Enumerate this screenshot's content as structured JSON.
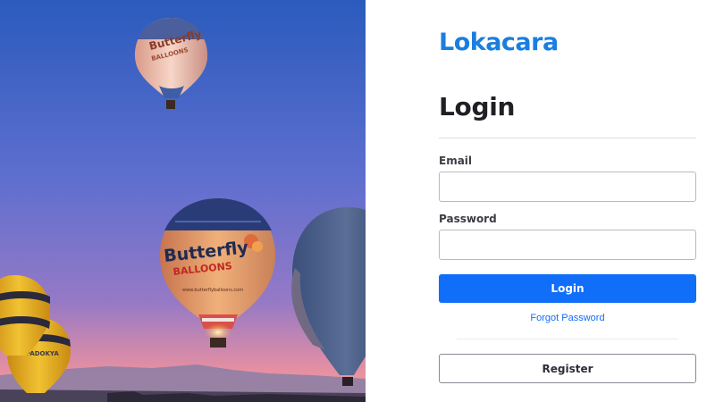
{
  "brand": {
    "name": "Lokacara",
    "color": "#1a7ee0"
  },
  "hero": {
    "balloon_main_text": "Butterfly",
    "balloon_main_subtext": "BALLOONS",
    "balloon_main_url": "www.butterflyballoons.com",
    "balloon_top_text": "Butterfly",
    "balloon_top_subtext": "BALLOONS",
    "balloon_left_text": "KAPADOKYA",
    "sky_colors": {
      "top": "#2f5fc0",
      "middle": "#6f6fd0",
      "bottom": "#e893a6"
    }
  },
  "form": {
    "title": "Login",
    "email_label": "Email",
    "email_value": "",
    "password_label": "Password",
    "password_value": "",
    "login_label": "Login",
    "forgot_label": "Forgot Password",
    "register_label": "Register",
    "primary_color": "#116ef9"
  }
}
